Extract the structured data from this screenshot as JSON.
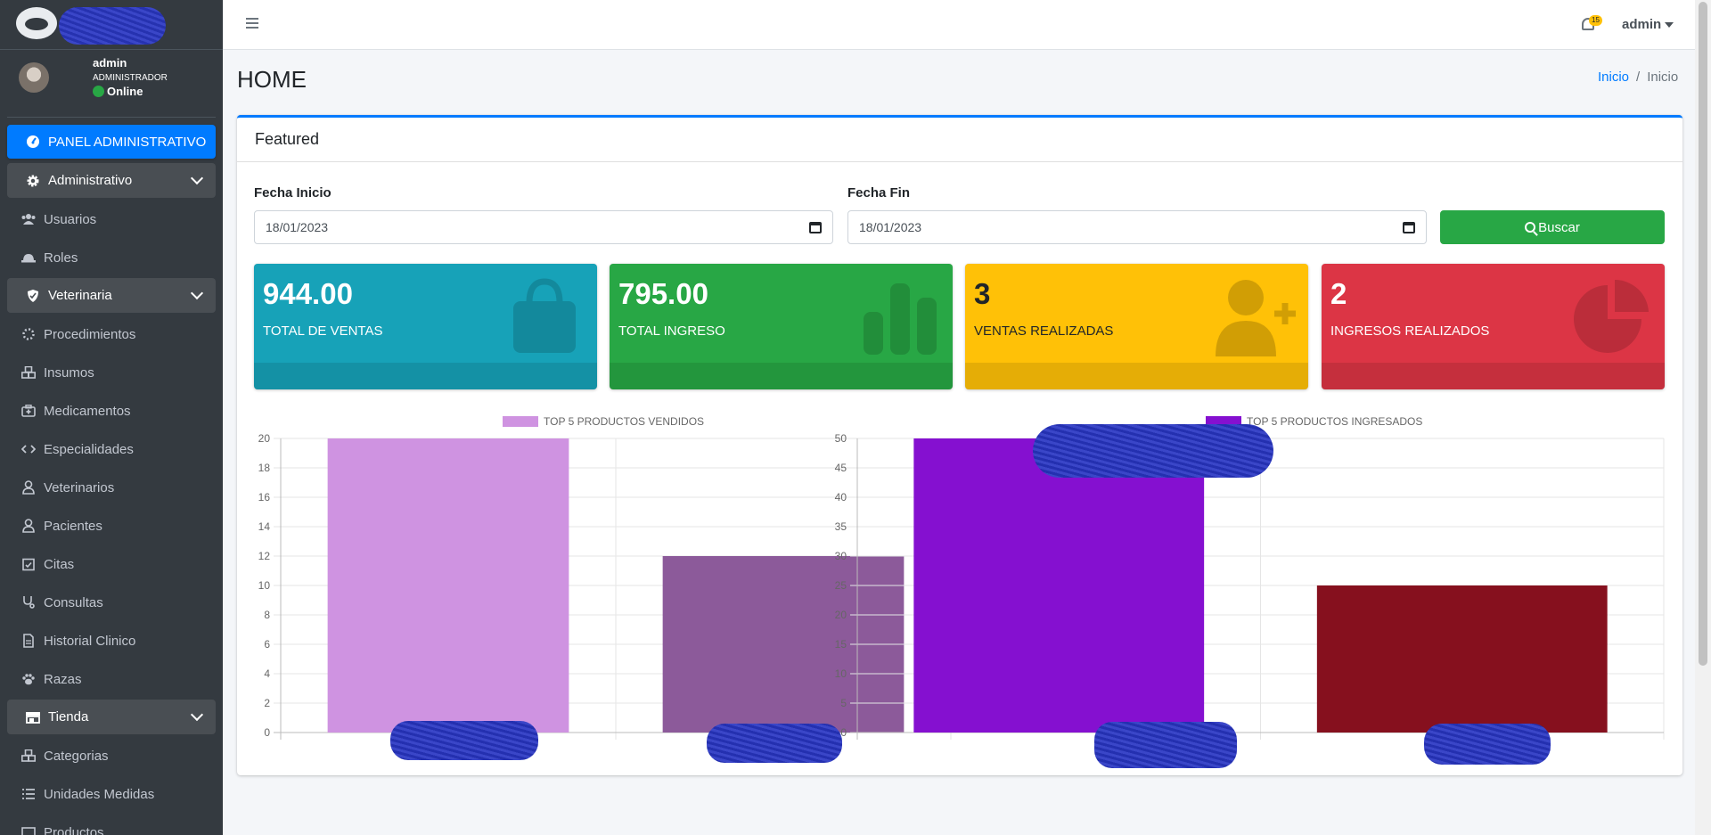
{
  "sidebar": {
    "user": {
      "name": "admin",
      "role": "ADMINISTRADOR",
      "status": "Online"
    },
    "items": [
      {
        "label": "PANEL ADMINISTRATIVO",
        "icon": "gauge-icon"
      },
      {
        "label": "Administrativo",
        "icon": "gear-icon"
      },
      {
        "label": "Usuarios",
        "icon": "users-icon"
      },
      {
        "label": "Roles",
        "icon": "hardhat-icon"
      },
      {
        "label": "Veterinaria",
        "icon": "shield-icon"
      },
      {
        "label": "Procedimientos",
        "icon": "spinner-icon"
      },
      {
        "label": "Insumos",
        "icon": "cubes-icon"
      },
      {
        "label": "Medicamentos",
        "icon": "medkit-icon"
      },
      {
        "label": "Especialidades",
        "icon": "code-icon"
      },
      {
        "label": "Veterinarios",
        "icon": "user-doctor-icon"
      },
      {
        "label": "Pacientes",
        "icon": "user-injured-icon"
      },
      {
        "label": "Citas",
        "icon": "calendar-check-icon"
      },
      {
        "label": "Consultas",
        "icon": "stethoscope-icon"
      },
      {
        "label": "Historial Clinico",
        "icon": "file-icon"
      },
      {
        "label": "Razas",
        "icon": "paw-icon"
      },
      {
        "label": "Tienda",
        "icon": "store-icon"
      },
      {
        "label": "Categorias",
        "icon": "cubes-icon"
      },
      {
        "label": "Unidades Medidas",
        "icon": "list-icon"
      },
      {
        "label": "Productos",
        "icon": "box-icon"
      }
    ]
  },
  "navbar": {
    "notification_count": "15",
    "user": "admin"
  },
  "header": {
    "title": "HOME",
    "breadcrumb": [
      "Inicio",
      "Inicio"
    ]
  },
  "card": {
    "title": "Featured",
    "filters": {
      "start_label": "Fecha Inicio",
      "start_value": "18/01/2023",
      "end_label": "Fecha Fin",
      "end_value": "18/01/2023",
      "search_label": "Buscar"
    },
    "boxes": [
      {
        "value": "944.00",
        "caption": "TOTAL DE VENTAS",
        "color": "#17a2b8",
        "icon": "shopping-bag-icon"
      },
      {
        "value": "795.00",
        "caption": "TOTAL INGRESO",
        "color": "#28a745",
        "icon": "bar-chart-icon"
      },
      {
        "value": "3",
        "caption": "VENTAS REALIZADAS",
        "color": "#ffc107",
        "icon": "user-plus-icon"
      },
      {
        "value": "2",
        "caption": "INGRESOS REALIZADOS",
        "color": "#dc3545",
        "icon": "pie-chart-icon"
      }
    ]
  },
  "chart_data": [
    {
      "type": "bar",
      "legend": "TOP 5 PRODUCTOS VENDIDOS",
      "legend_color": "#cf93e1",
      "ylim": [
        0,
        20
      ],
      "yticks": [
        0,
        2,
        4,
        6,
        8,
        10,
        12,
        14,
        16,
        18,
        20
      ],
      "values": [
        20,
        12
      ],
      "colors": [
        "#cf93e1",
        "#8c5a9a"
      ],
      "grid": true
    },
    {
      "type": "bar",
      "legend": "TOP 5 PRODUCTOS INGRESADOS",
      "legend_color": "#8510d0",
      "ylim": [
        0,
        50
      ],
      "yticks": [
        0,
        5,
        10,
        15,
        20,
        25,
        30,
        35,
        40,
        45,
        50
      ],
      "values": [
        50,
        25
      ],
      "colors": [
        "#8510d0",
        "#86101e"
      ],
      "grid": true
    }
  ]
}
